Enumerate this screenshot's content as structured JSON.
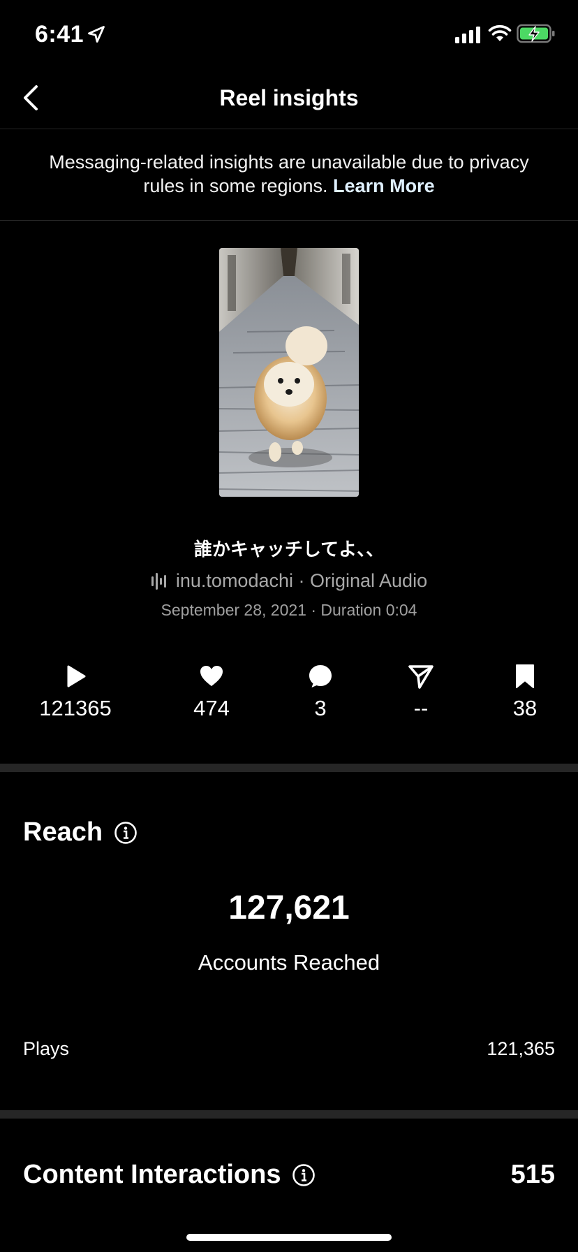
{
  "status_bar": {
    "time": "6:41"
  },
  "nav": {
    "title": "Reel insights"
  },
  "notice": {
    "text": "Messaging-related insights are unavailable due to privacy rules in some regions.",
    "link": "Learn More"
  },
  "reel": {
    "caption": "誰かキャッチしてよ、、",
    "audio": "inu.tomodachi · Original Audio",
    "meta": "September 28, 2021 · Duration 0:04"
  },
  "stats": {
    "plays": "121365",
    "likes": "474",
    "comments": "3",
    "shares": "--",
    "saves": "38"
  },
  "reach": {
    "title": "Reach",
    "accounts_reached_value": "127,621",
    "accounts_reached_label": "Accounts Reached",
    "plays_label": "Plays",
    "plays_value": "121,365"
  },
  "interactions": {
    "title": "Content Interactions",
    "value": "515"
  },
  "icons": {
    "status": [
      "location-arrow-icon",
      "signal-icon",
      "wifi-icon",
      "battery-charging-icon"
    ],
    "stats": [
      "play-icon",
      "heart-icon",
      "comment-icon",
      "send-icon",
      "bookmark-icon"
    ]
  },
  "colors": {
    "background": "#000000",
    "divider": "#262626",
    "secondary_text": "#a8a8a8",
    "battery_green": "#4cd964"
  }
}
